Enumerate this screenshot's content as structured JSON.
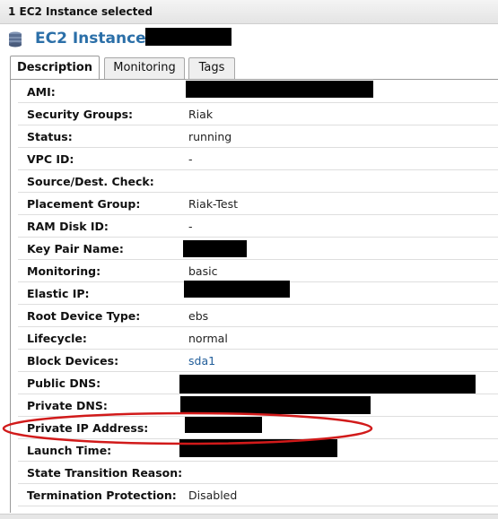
{
  "selection_status": "1 EC2 Instance selected",
  "header": {
    "title": "EC2 Instance:",
    "icon": "database-icon"
  },
  "tabs": [
    {
      "label": "Description",
      "active": true
    },
    {
      "label": "Monitoring",
      "active": false
    },
    {
      "label": "Tags",
      "active": false
    }
  ],
  "details": [
    {
      "label": "AMI:",
      "value": "",
      "redacted": true
    },
    {
      "label": "Security Groups:",
      "value": "Riak"
    },
    {
      "label": "Status:",
      "value": "running"
    },
    {
      "label": "VPC ID:",
      "value": "-"
    },
    {
      "label": "Source/Dest. Check:",
      "value": ""
    },
    {
      "label": "Placement Group:",
      "value": "Riak-Test"
    },
    {
      "label": "RAM Disk ID:",
      "value": "-"
    },
    {
      "label": "Key Pair Name:",
      "value": "",
      "redacted": true
    },
    {
      "label": "Monitoring:",
      "value": "basic"
    },
    {
      "label": "Elastic IP:",
      "value": "",
      "redacted": true
    },
    {
      "label": "Root Device Type:",
      "value": "ebs"
    },
    {
      "label": "Lifecycle:",
      "value": "normal"
    },
    {
      "label": "Block Devices:",
      "value": "sda1",
      "link": true
    },
    {
      "label": "Public DNS:",
      "value": "",
      "redacted": true
    },
    {
      "label": "Private DNS:",
      "value": "",
      "redacted": true
    },
    {
      "label": "Private IP Address:",
      "value": "",
      "redacted": true,
      "highlighted": true
    },
    {
      "label": "Launch Time:",
      "value": "",
      "redacted": true
    },
    {
      "label": "State Transition Reason:",
      "value": ""
    },
    {
      "label": "Termination Protection:",
      "value": "Disabled"
    }
  ],
  "colors": {
    "title": "#2b6fa8",
    "link": "#1f5c99",
    "highlight_ellipse": "#d11a1a",
    "redaction": "#000000"
  }
}
